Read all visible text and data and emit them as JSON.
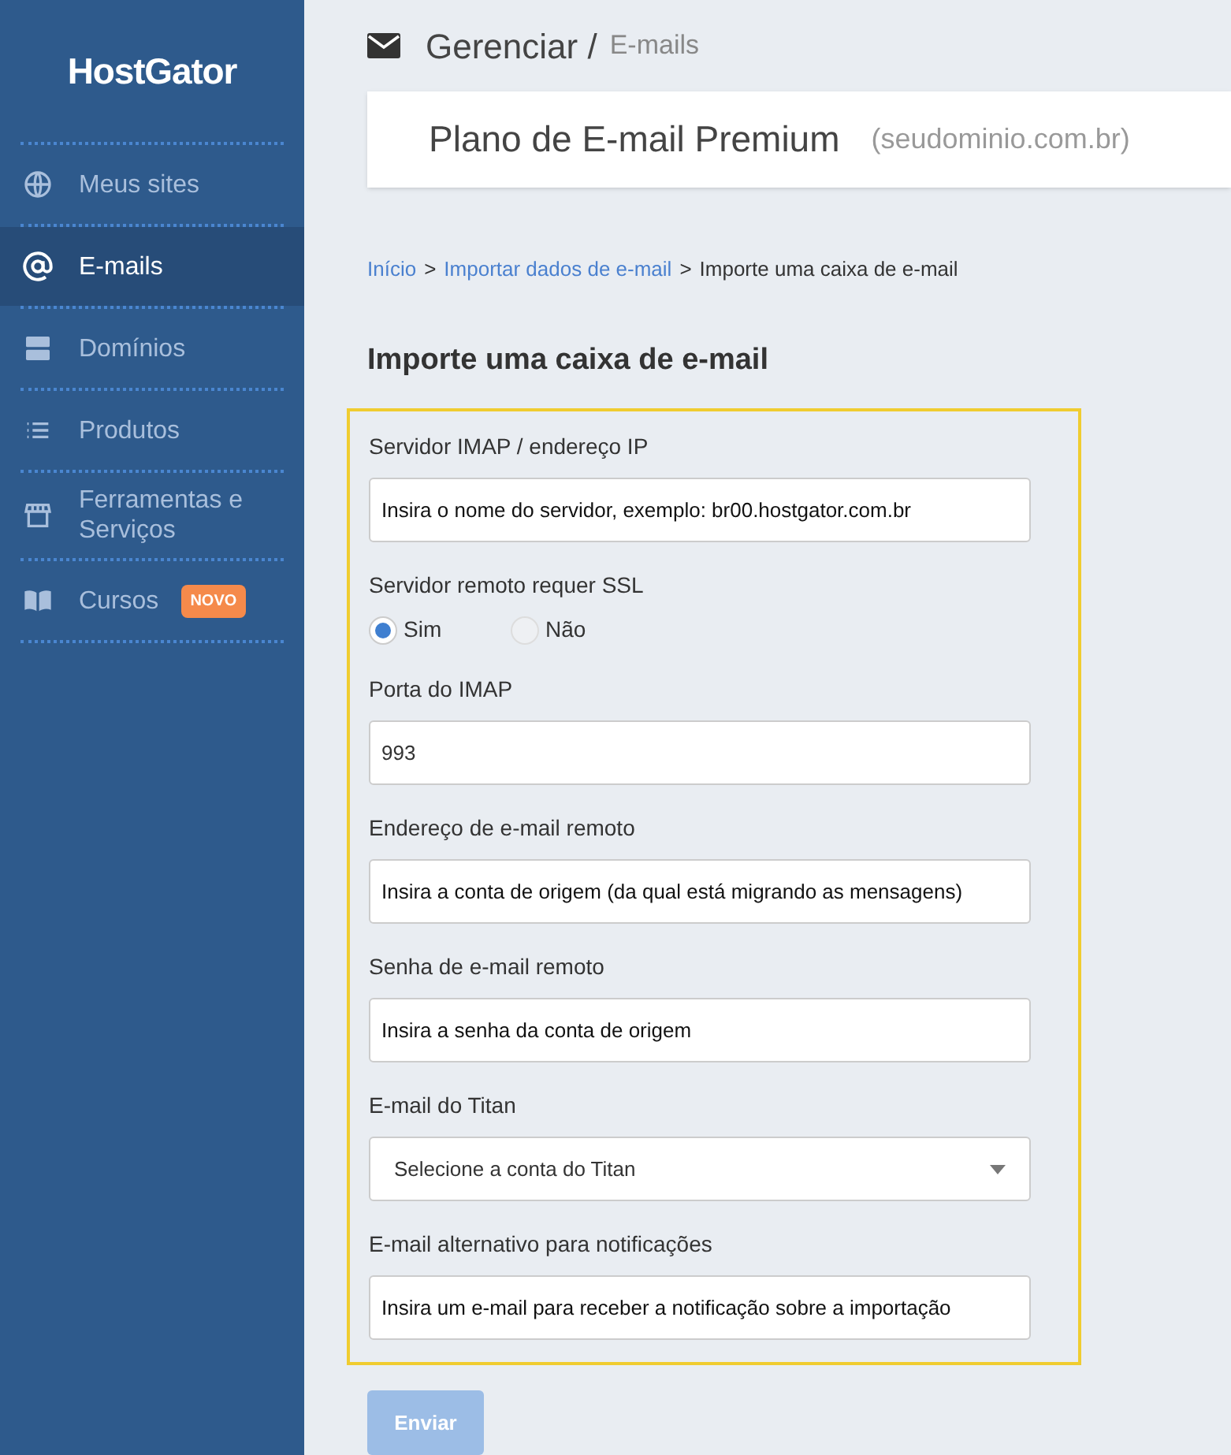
{
  "sidebar": {
    "logo": "HostGator",
    "items": [
      {
        "label": "Meus sites",
        "selected": false
      },
      {
        "label": "E-mails",
        "selected": true
      },
      {
        "label": "Domínios",
        "selected": false
      },
      {
        "label": "Produtos",
        "selected": false
      },
      {
        "label": "Ferramentas e Serviços",
        "selected": false
      },
      {
        "label": "Cursos",
        "selected": false,
        "badge": "NOVO"
      }
    ]
  },
  "header": {
    "title": "Gerenciar /",
    "subtitle": "E-mails"
  },
  "plan": {
    "name": "Plano de E-mail Premium",
    "domain": "(seudominio.com.br)"
  },
  "breadcrumb": [
    {
      "label": "Início",
      "kind": "link"
    },
    {
      "label": ">",
      "kind": "separator"
    },
    {
      "label": "Importar dados de e-mail",
      "kind": "link"
    },
    {
      "label": ">",
      "kind": "separator"
    },
    {
      "label": "Importe uma caixa de e-mail",
      "kind": "current"
    }
  ],
  "form": {
    "title": "Importe uma caixa de e-mail",
    "fields": [
      {
        "kind": "text",
        "label": "Servidor IMAP / endereço IP",
        "placeholder": "Insira o nome do servidor, exemplo: br00.hostgator.com.br"
      },
      {
        "kind": "radio",
        "label": "Servidor remoto requer SSL",
        "options": [
          {
            "label": "Sim",
            "selected": true
          },
          {
            "label": "Não",
            "selected": false
          }
        ]
      },
      {
        "kind": "text",
        "label": "Porta do IMAP",
        "value": "993"
      },
      {
        "kind": "text",
        "label": "Endereço de e-mail remoto",
        "placeholder": "Insira a conta de origem (da qual está migrando as mensagens)"
      },
      {
        "kind": "text",
        "label": "Senha de e-mail remoto",
        "placeholder": "Insira a senha da conta de origem"
      },
      {
        "kind": "select",
        "label": "E-mail do Titan",
        "value": "Selecione a conta do Titan"
      },
      {
        "kind": "text",
        "label": "E-mail alternativo para notificações",
        "placeholder": "Insira um e-mail para receber a notificação sobre a importação"
      }
    ],
    "submit": {
      "label": "Enviar",
      "disabled": true
    }
  }
}
